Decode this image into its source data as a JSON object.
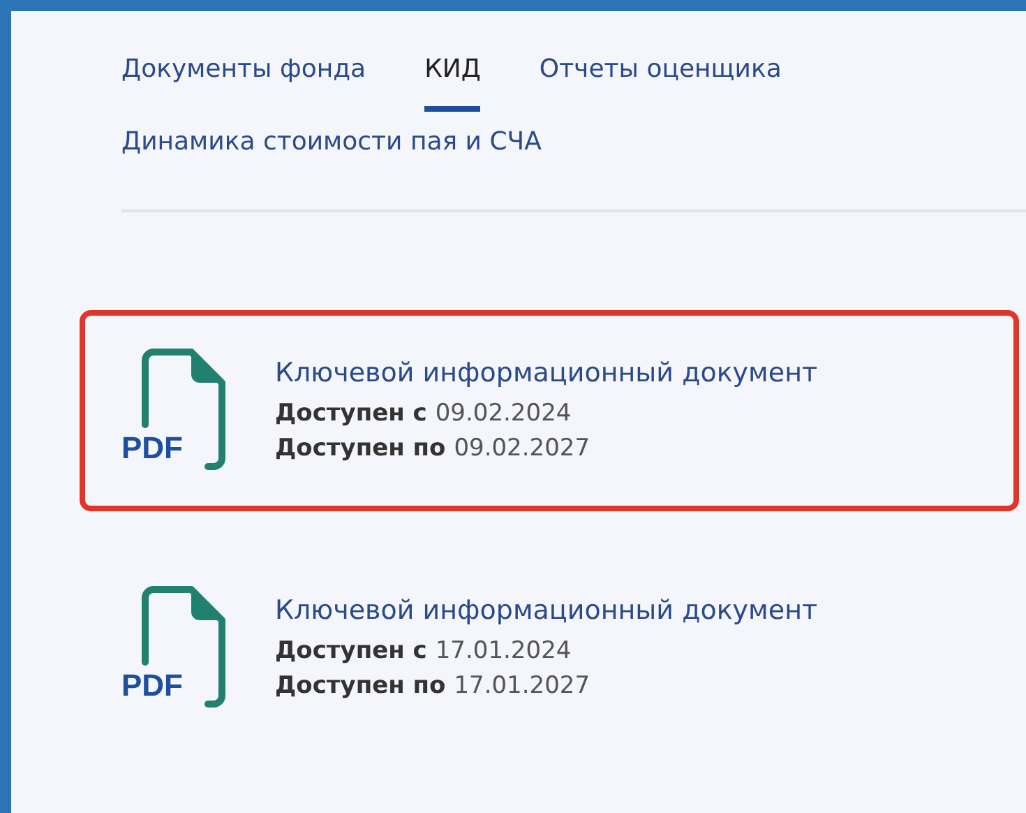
{
  "tabs": [
    {
      "label": "Документы фонда",
      "selected": false
    },
    {
      "label": "КИД",
      "selected": true
    },
    {
      "label": "Отчеты оценщика",
      "selected": false
    },
    {
      "label": "Динамика стоимости пая и СЧА",
      "selected": false
    }
  ],
  "documents": [
    {
      "icon_label": "PDF",
      "title": "Ключевой информационный документ",
      "from_label": "Доступен с",
      "from_date": "09.02.2024",
      "to_label": "Доступен по",
      "to_date": "09.02.2027",
      "highlighted": true
    },
    {
      "icon_label": "PDF",
      "title": "Ключевой информационный документ",
      "from_label": "Доступен с",
      "from_date": "17.01.2024",
      "to_label": "Доступен по",
      "to_date": "17.01.2027",
      "highlighted": false
    }
  ]
}
